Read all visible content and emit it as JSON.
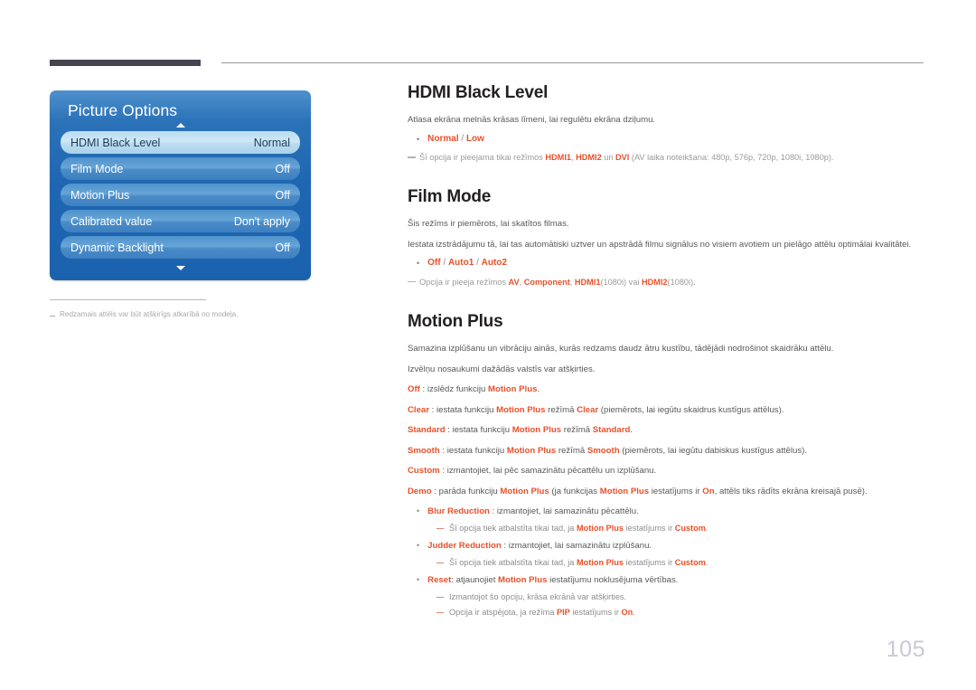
{
  "page": {
    "number": "105",
    "accent_color": "#e8512a",
    "header_bar_color": "#474451"
  },
  "osd": {
    "title": "Picture Options",
    "scroll_up_icon": "triangle-up-icon",
    "scroll_down_icon": "triangle-down-icon",
    "rows": [
      {
        "label": "HDMI Black Level",
        "value": "Normal",
        "selected": true
      },
      {
        "label": "Film Mode",
        "value": "Off",
        "selected": false
      },
      {
        "label": "Motion Plus",
        "value": "Off",
        "selected": false
      },
      {
        "label": "Calibrated value",
        "value": "Don't apply",
        "selected": false
      },
      {
        "label": "Dynamic Backlight",
        "value": "Off",
        "selected": false
      }
    ],
    "footnote": "Redzamais attēls var būt atšķirīgs atkarībā no modeļa."
  },
  "sections": {
    "hdmi_black_level": {
      "title": "HDMI Black Level",
      "body": "Atlasa ekrāna melnās krāsas līmeni, lai regulētu ekrāna dziļumu.",
      "options_prefix": "Normal",
      "options_sep": " / ",
      "options_suffix": "Low",
      "note_pre": "Šī opcija ir pieejama tikai režīmos ",
      "note_b1": "HDMI1",
      "note_mid1": ", ",
      "note_b2": "HDMI2",
      "note_mid2": " un ",
      "note_b3": "DVI",
      "note_tail": " (AV laika noteikšana: 480p, 576p, 720p, 1080i, 1080p)."
    },
    "film_mode": {
      "title": "Film Mode",
      "body1": "Šis režīms ir piemērots, lai skatītos filmas.",
      "body2": "Iestata izstrādājumu tā, lai tas automātiski uztver un apstrādā filmu signālus no visiem avotiem un pielāgo attēlu optimālai kvalitātei.",
      "opt1": "Off",
      "opt2": "Auto1",
      "opt3": "Auto2",
      "note_pre": "Opcija ir pieeja režīmos ",
      "note_b1": "AV",
      "note_mid1": ", ",
      "note_b2": "Component",
      "note_mid2": ", ",
      "note_b3": "HDMI1",
      "note_mid3": "(1080i) vai ",
      "note_b4": "HDMI2",
      "note_tail": "(1080i)."
    },
    "motion_plus": {
      "title": "Motion Plus",
      "body1": "Samazina izplūšanu un vibrāciju ainās, kurās redzams daudz ātru kustību, tādējādi nodrošinot skaidrāku attēlu.",
      "body2": "Izvēlņu nosaukumi dažādās valstīs var atšķirties.",
      "defs": [
        {
          "key": "Off",
          "pre": " : izslēdz funkciju ",
          "b1": "Motion Plus",
          "tail": "."
        },
        {
          "key": "Clear",
          "pre": " : iestata funkciju ",
          "b1": "Motion Plus",
          "mid": " režīmā ",
          "b2": "Clear",
          "tail": " (piemērots, lai iegūtu skaidrus kustīgus attēlus)."
        },
        {
          "key": "Standard",
          "pre": " : iestata funkciju ",
          "b1": "Motion Plus",
          "mid": " režīmā ",
          "b2": "Standard",
          "tail": "."
        },
        {
          "key": "Smooth",
          "pre": " : iestata funkciju ",
          "b1": "Motion Plus",
          "mid": " režīmā ",
          "b2": "Smooth",
          "tail": " (piemērots, lai iegūtu dabiskus kustīgus attēlus)."
        },
        {
          "key": "Custom",
          "pre": " : izmantojiet, lai pēc samazinātu pēcattēlu un izplūšanu.",
          "b1": "",
          "mid": "",
          "b2": "",
          "tail": ""
        },
        {
          "key": "Demo",
          "pre": " : parāda funkciju ",
          "b1": "Motion Plus",
          "mid": " (ja funkcijas ",
          "b2": "Motion Plus",
          "mid2": " iestatījums ir ",
          "b3": "On",
          "tail": ", attēls tiks rādīts ekrāna kreisajā pusē)."
        }
      ],
      "subitems": [
        {
          "key": "Blur Reduction",
          "text": " : izmantojiet, lai samazinātu pēcattēlu.",
          "notes": [
            {
              "pre": "Šī opcija tiek atbalstīta tikai tad, ja ",
              "b1": "Motion Plus",
              "mid": " iestatījums ir ",
              "b2": "Custom",
              "tail": "."
            }
          ]
        },
        {
          "key": "Judder Reduction",
          "text": " : izmantojiet, lai samazinātu izplūšanu.",
          "notes": [
            {
              "pre": "Šī opcija tiek atbalstīta tikai tad, ja ",
              "b1": "Motion Plus",
              "mid": " iestatījums ir ",
              "b2": "Custom",
              "tail": "."
            }
          ]
        },
        {
          "key": "Reset",
          "text": ": atjaunojiet ",
          "key_b1": "Motion Plus",
          "text_tail": " iestatījumu noklusējuma vērtības.",
          "notes": [
            {
              "pre": "Izmantojot šo opciju, krāsa ekrānā var atšķirties.",
              "b1": "",
              "mid": "",
              "b2": "",
              "tail": ""
            },
            {
              "pre": "Opcija ir atspējota, ja režīma ",
              "b1": "PIP",
              "mid": " iestatījums ir ",
              "b2": "On",
              "tail": "."
            }
          ]
        }
      ]
    }
  }
}
